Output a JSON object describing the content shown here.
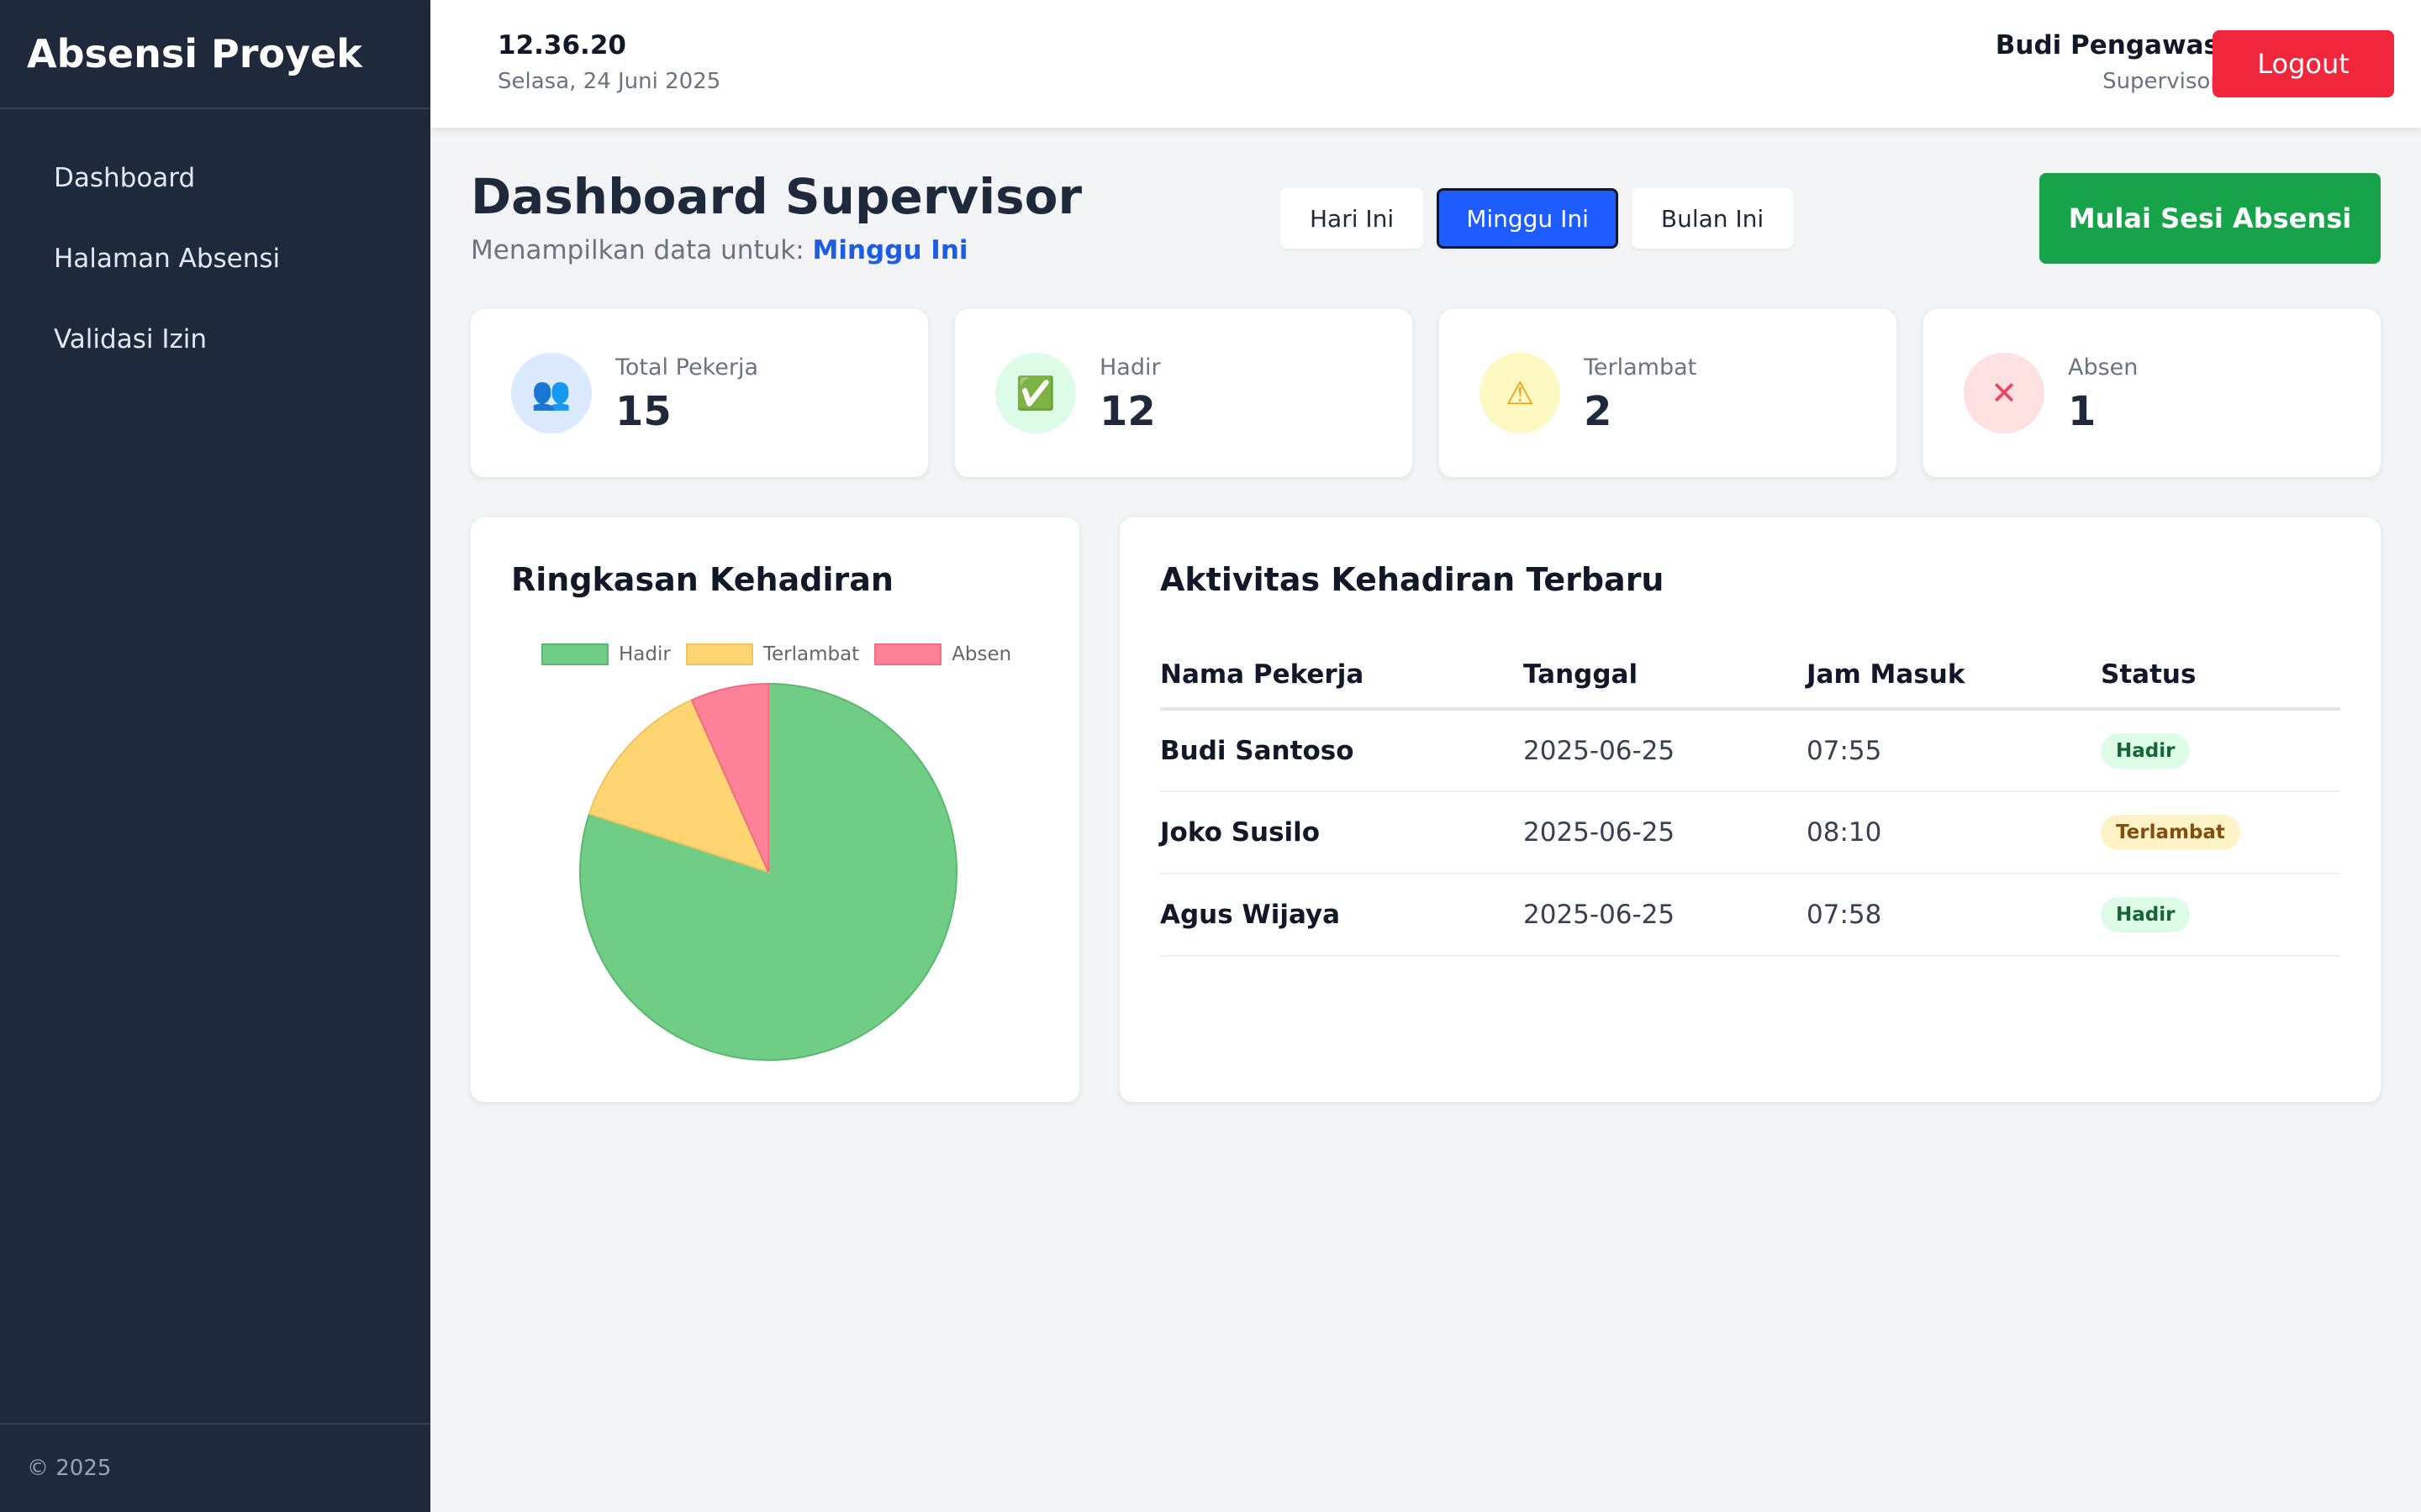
{
  "sidebar": {
    "brand": "Absensi Proyek",
    "items": [
      {
        "label": "Dashboard"
      },
      {
        "label": "Halaman Absensi"
      },
      {
        "label": "Validasi Izin"
      }
    ],
    "footer": "© 2025"
  },
  "header": {
    "time": "12.36.20",
    "date": "Selasa, 24 Juni 2025",
    "user_name": "Budi Pengawas",
    "user_role": "Supervisor",
    "logout_label": "Logout"
  },
  "main": {
    "title": "Dashboard Supervisor",
    "subtitle_prefix": "Menampilkan data untuk:",
    "subtitle_period": "Minggu Ini",
    "filters": [
      {
        "label": "Hari Ini",
        "active": false
      },
      {
        "label": "Minggu Ini",
        "active": true
      },
      {
        "label": "Bulan Ini",
        "active": false
      }
    ],
    "start_label": "Mulai Sesi Absensi"
  },
  "stats": [
    {
      "label": "Total Pekerja",
      "value": "15",
      "icon": "users-icon",
      "glyph": "👥",
      "bg": "#dbeafe",
      "color": "#6d28d9"
    },
    {
      "label": "Hadir",
      "value": "12",
      "icon": "check-box-icon",
      "glyph": "✅",
      "bg": "#dcfce7",
      "color": "#16a34a"
    },
    {
      "label": "Terlambat",
      "value": "2",
      "icon": "warning-icon",
      "glyph": "⚠",
      "bg": "#fef9c3",
      "color": "#f59e0b"
    },
    {
      "label": "Absen",
      "value": "1",
      "icon": "cross-icon",
      "glyph": "✕",
      "bg": "#fee2e2",
      "color": "#ef4460"
    }
  ],
  "summary_panel": {
    "title": "Ringkasan Kehadiran"
  },
  "chart_data": {
    "type": "pie",
    "categories": [
      "Hadir",
      "Terlambat",
      "Absen"
    ],
    "values": [
      12,
      2,
      1
    ],
    "colors": [
      "#6fcd85",
      "#ffd574",
      "#ff8398"
    ],
    "borders": [
      "#5ab870",
      "#f0c45a",
      "#f26a83"
    ],
    "legend": "top"
  },
  "activity_panel": {
    "title": "Aktivitas Kehadiran Terbaru",
    "columns": [
      "Nama Pekerja",
      "Tanggal",
      "Jam Masuk",
      "Status"
    ],
    "rows": [
      {
        "name": "Budi Santoso",
        "date": "2025-06-25",
        "time": "07:55",
        "status": "Hadir",
        "kind": "hadir"
      },
      {
        "name": "Joko Susilo",
        "date": "2025-06-25",
        "time": "08:10",
        "status": "Terlambat",
        "kind": "terlambat"
      },
      {
        "name": "Agus Wijaya",
        "date": "2025-06-25",
        "time": "07:58",
        "status": "Hadir",
        "kind": "hadir"
      }
    ]
  }
}
